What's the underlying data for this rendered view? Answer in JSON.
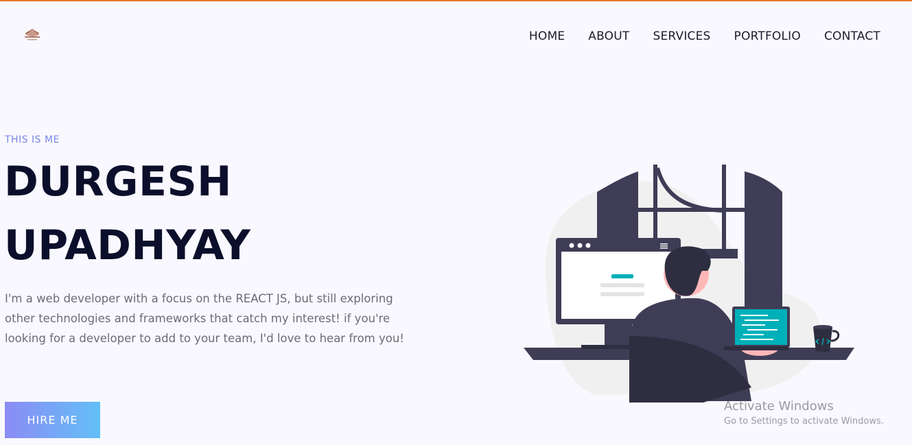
{
  "header": {
    "nav": [
      "HOME",
      "ABOUT",
      "SERVICES",
      "PORTFOLIO",
      "CONTACT"
    ]
  },
  "hero": {
    "eyebrow": "THIS IS ME",
    "name_line1": "DURGESH",
    "name_line2": "UPADHYAY",
    "intro": "I'm a web developer with a focus on the REACT JS, but still exploring other technologies and frameworks that catch my interest! if you're looking for a developer to add to your team, I'd love to hear from you!",
    "cta_label": "HIRE ME"
  },
  "watermark": {
    "title": "Activate Windows",
    "subtitle": "Go to Settings to activate Windows."
  },
  "colors": {
    "accent_top_bar": "#e8772e",
    "eyebrow": "#7b86e6",
    "heading": "#0b0f2b",
    "button_gradient_start": "#8b8cf5",
    "button_gradient_end": "#63bff6",
    "illustration_dark": "#3f3d56",
    "illustration_teal": "#00b0b9"
  }
}
